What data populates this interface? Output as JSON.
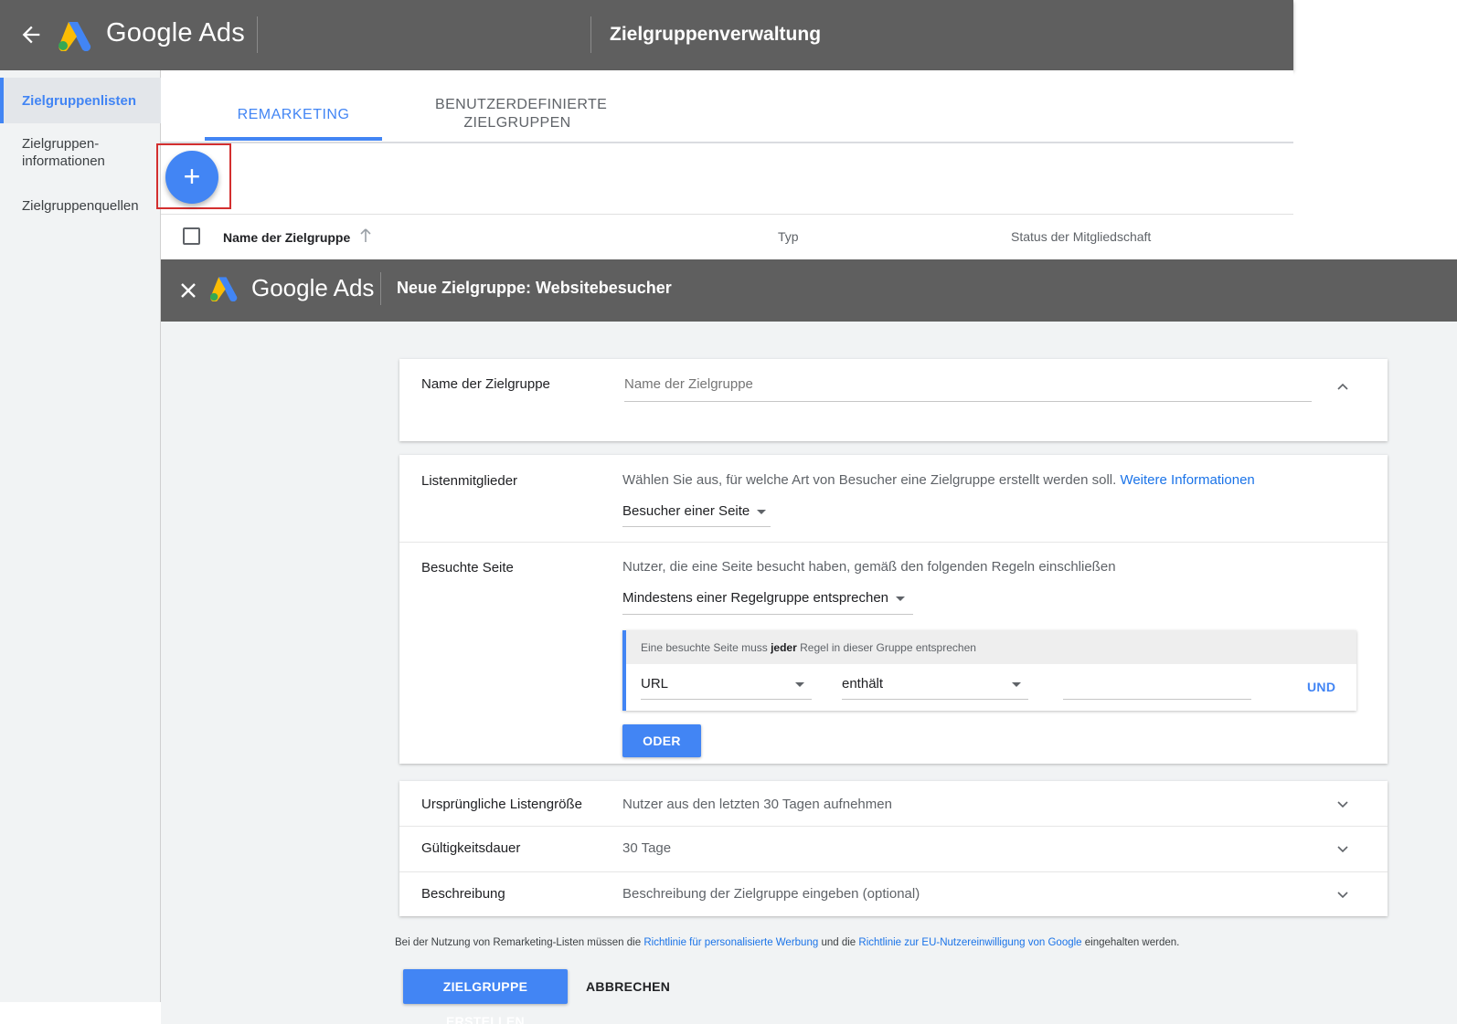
{
  "top": {
    "brand": "Google Ads",
    "title": "Zielgruppenverwaltung"
  },
  "sidebar": {
    "items": [
      {
        "label": "Zielgruppenlisten"
      },
      {
        "label_line1": "Zielgruppen-",
        "label_line2": "informationen"
      },
      {
        "label": "Zielgruppenquellen"
      }
    ]
  },
  "tabs": {
    "remarketing": "REMARKETING",
    "custom_line1": "BENUTZERDEFINIERTE",
    "custom_line2": "ZIELGRUPPEN"
  },
  "fab": {
    "label": "+"
  },
  "table": {
    "col_name": "Name der Zielgruppe",
    "col_type": "Typ",
    "col_status": "Status der Mitgliedschaft"
  },
  "overlay": {
    "brand": "Google Ads",
    "title": "Neue Zielgruppe: Websitebesucher",
    "name_card": {
      "label": "Name der Zielgruppe",
      "placeholder": "Name der Zielgruppe"
    },
    "members": {
      "label": "Listenmitglieder",
      "description": "Wählen Sie aus, für welche Art von Besucher eine Zielgruppe erstellt werden soll.",
      "link": "Weitere Informationen",
      "select": "Besucher einer Seite"
    },
    "visited": {
      "label": "Besuchte Seite",
      "description": "Nutzer, die eine Seite besucht haben, gemäß den folgenden Regeln einschließen",
      "select": "Mindestens einer Regelgruppe entsprechen",
      "rule_head_pre": "Eine besuchte Seite muss",
      "rule_head_bold": "jeder",
      "rule_head_post": "Regel in dieser Gruppe entsprechen",
      "field": "URL",
      "operator": "enthält",
      "value": "",
      "and_button": "UND",
      "or_button": "ODER"
    },
    "list_size": {
      "label": "Ursprüngliche Listengröße",
      "value": "Nutzer aus den letzten 30 Tagen aufnehmen"
    },
    "duration": {
      "label": "Gültigkeitsdauer",
      "value": "30 Tage"
    },
    "description": {
      "label": "Beschreibung",
      "value": "Beschreibung der Zielgruppe eingeben (optional)"
    },
    "footer": {
      "pre": "Bei der Nutzung von Remarketing-Listen müssen die",
      "link1": "Richtlinie für personalisierte Werbung",
      "mid": "und die",
      "link2": "Richtlinie zur EU-Nutzereinwilligung von Google",
      "post": "eingehalten werden."
    },
    "create_button": "ZIELGRUPPE ERSTELLEN",
    "cancel_button": "ABBRECHEN"
  },
  "colors": {
    "accent": "#4285f4",
    "bar": "#5f5f5f",
    "highlight_frame": "#d32f2f"
  }
}
